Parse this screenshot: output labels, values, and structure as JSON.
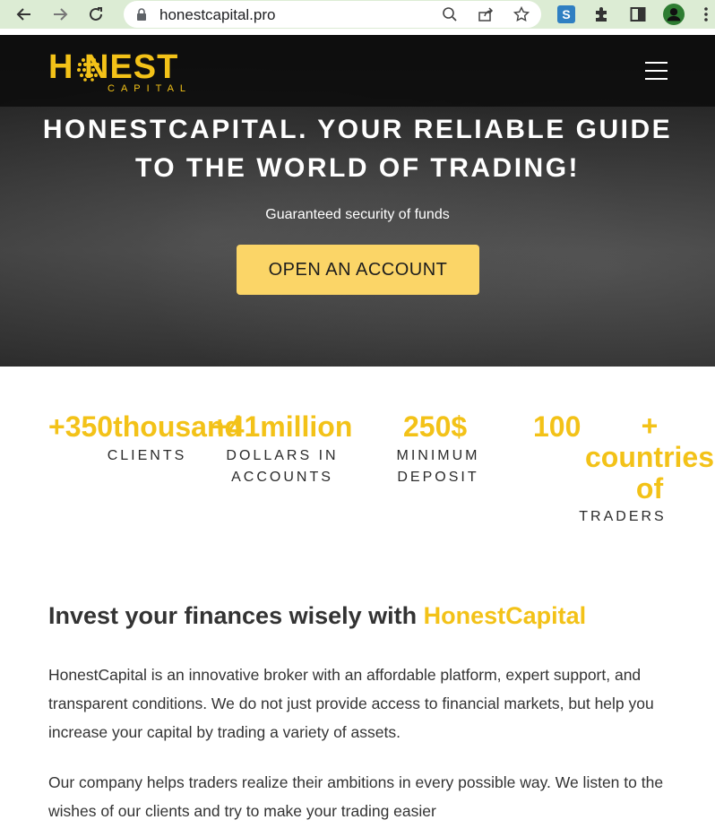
{
  "browser": {
    "url": "honestcapital.pro"
  },
  "header": {
    "logo_main": "H NEST",
    "logo_sub": "CAPITAL"
  },
  "hero": {
    "title": "HONESTCAPITAL. YOUR RELIABLE GUIDE TO THE WORLD OF TRADING!",
    "subtitle": "Guaranteed security of funds",
    "cta_label": "OPEN AN ACCOUNT"
  },
  "stats": [
    {
      "value": "+350thousand",
      "label": "CLIENTS"
    },
    {
      "value": "+41million",
      "label": "DOLLARS IN ACCOUNTS"
    },
    {
      "value": "250$",
      "label": "MINIMUM DEPOSIT"
    },
    {
      "value": "100",
      "value_extra": "+ countries of",
      "label": "TRADERS"
    }
  ],
  "content": {
    "heading_prefix": "Invest your finances wisely with ",
    "heading_accent": "HonestCapital",
    "paragraph_1": "HonestCapital is an innovative broker with an affordable platform, expert support, and transparent conditions. We do not just provide access to financial markets, but help you increase your capital by trading a variety of assets.",
    "paragraph_2": "Our company helps traders realize their ambitions in every possible way. We listen to the wishes of our clients and try to make your trading easier"
  },
  "colors": {
    "accent": "#f3c218",
    "cta_bg": "#fbd567",
    "chrome_bg": "#dcecd4",
    "text": "#333333"
  }
}
